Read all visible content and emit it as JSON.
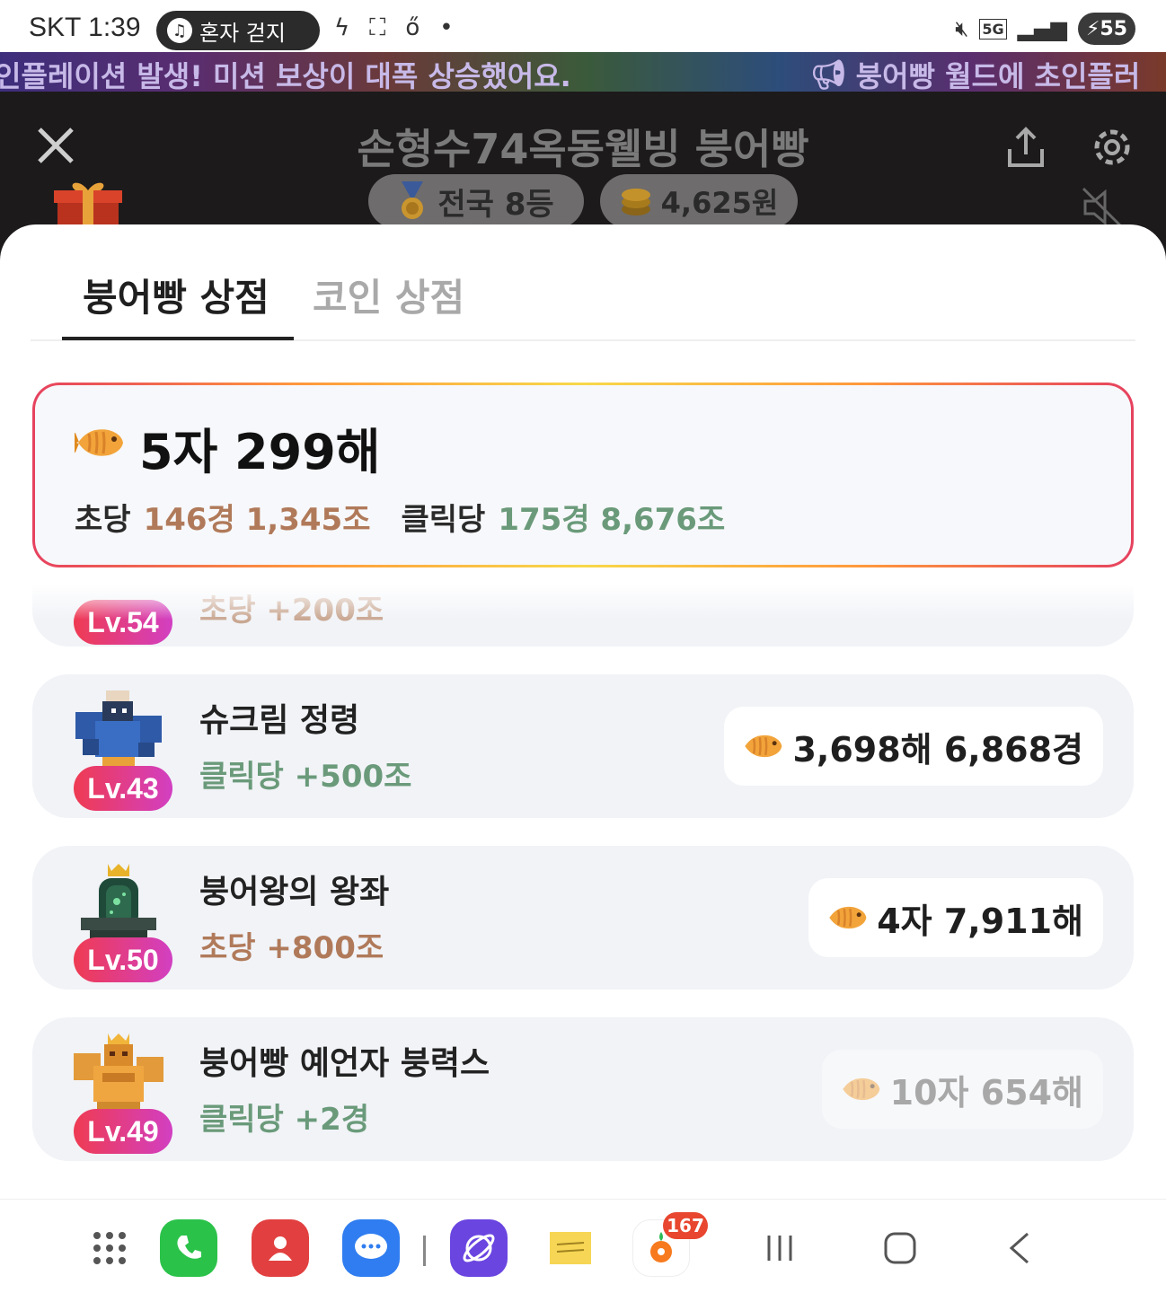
{
  "status_bar": {
    "time": "SKT 1:39",
    "now_playing": "혼자 걷지",
    "network": "5G",
    "battery": "55"
  },
  "ticker": {
    "left_text": "인플레이션 발생! 미션 보상이 대폭 상승했어요.",
    "right_text": "붕어빵 월드에 초인플러"
  },
  "header": {
    "title": "손형수74옥동웰빙 붕어빵",
    "rank": "전국 8등",
    "coins": "4,625원"
  },
  "tabs": [
    {
      "label": "붕어빵 상점",
      "active": true
    },
    {
      "label": "코인 상점",
      "active": false
    }
  ],
  "summary": {
    "total": "5자 299해",
    "per_sec_label": "초당",
    "per_sec_value": "146경 1,345조",
    "per_click_label": "클릭당",
    "per_click_value": "175경 8,676조"
  },
  "partial_item": {
    "level": "Lv.54",
    "effect": "초당 +200조"
  },
  "items": [
    {
      "name": "슈크림 정령",
      "level": "Lv.43",
      "effect": "클릭당 +500조",
      "effect_type": "click",
      "price": "3,698해 6,868경",
      "affordable": true,
      "art": "cream-spirit"
    },
    {
      "name": "붕어왕의 왕좌",
      "level": "Lv.50",
      "effect": "초당 +800조",
      "effect_type": "sec",
      "price": "4자 7,911해",
      "affordable": true,
      "art": "king-throne"
    },
    {
      "name": "붕어빵 예언자 붕력스",
      "level": "Lv.49",
      "effect": "클릭당 +2경",
      "effect_type": "click",
      "price": "10자 654해",
      "affordable": false,
      "art": "golden-prophet"
    }
  ],
  "nav": {
    "store_badge": "167"
  },
  "colors": {
    "accent_gradient_start": "#ef3b52",
    "accent_gradient_end": "#d23fc2",
    "per_sec": "#b07a5a",
    "per_click": "#6a9a7a"
  }
}
